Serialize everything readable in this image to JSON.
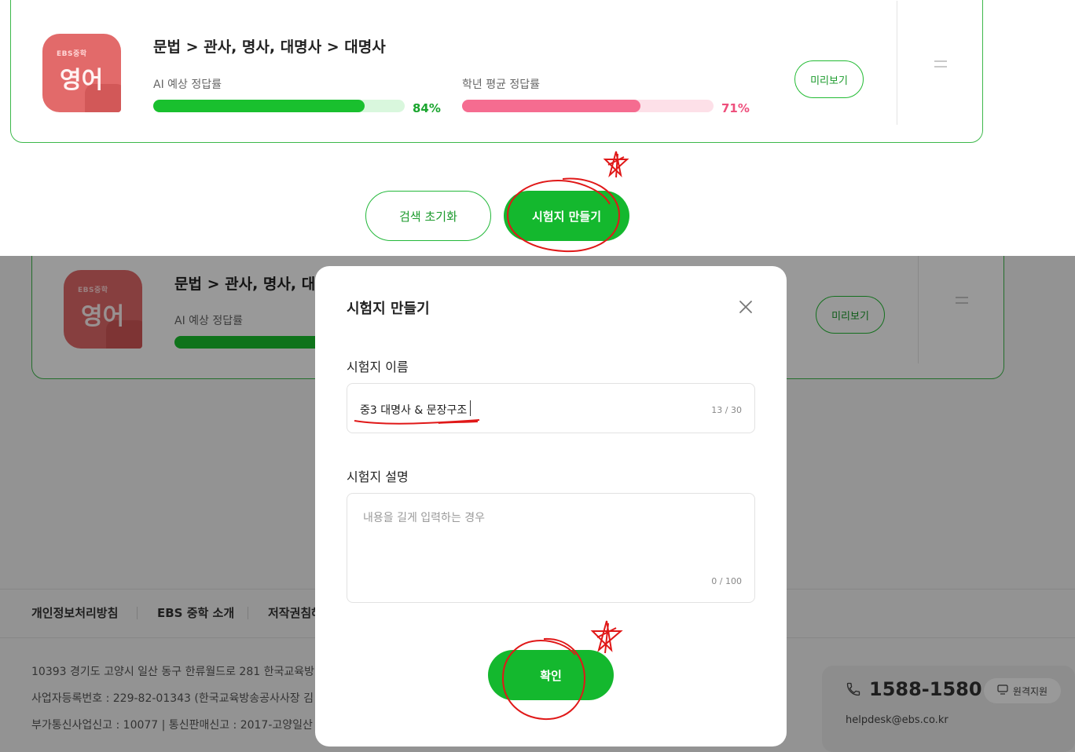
{
  "card": {
    "thumb_small": "EBS중학",
    "thumb_big": "영어",
    "title": "문법 > 관사, 명사, 대명사 > 대명사",
    "ai_label": "AI 예상 정답률",
    "ai_value": 0.84,
    "ai_pct": "84%",
    "grade_label": "학년 평균 정답률",
    "grade_value": 0.71,
    "grade_pct": "71%",
    "preview_label": "미리보기"
  },
  "actions": {
    "reset_label": "검색 초기화",
    "create_label": "시험지 만들기"
  },
  "footer": {
    "links": [
      "개인정보처리방침",
      "EBS 중학 소개",
      "저작권침해"
    ],
    "address": "10393 경기도 고양시 일산 동구 한류월드로 281 한국교육방",
    "business": "사업자등록번호 : 229-82-01343 (한국교육방송공사사장 김",
    "telecom": "부가통신사업신고 : 10077  |  통신판매신고 : 2017-고양일산",
    "phone": "1588-1580",
    "remote_label": "원격지원",
    "email": "helpdesk@ebs.co.kr"
  },
  "modal": {
    "title": "시험지 만들기",
    "name_label": "시험지 이름",
    "name_value": "중3 대명사 & 문장구조",
    "name_counter": "13 / 30",
    "desc_label": "시험지 설명",
    "desc_placeholder": "내용을 길게 입력하는 경우",
    "desc_counter": "0 / 100",
    "confirm_label": "확인"
  },
  "colors": {
    "brand_green": "#14b82e",
    "ai_bar": "#19c02e",
    "ai_track": "#d9f7dd",
    "grade_bar": "#f56c90",
    "grade_track": "#fde0e8",
    "annotation_red": "#e01818"
  },
  "icons": [
    "close-icon",
    "phone-icon",
    "monitor-icon",
    "drag-handle-icon"
  ]
}
